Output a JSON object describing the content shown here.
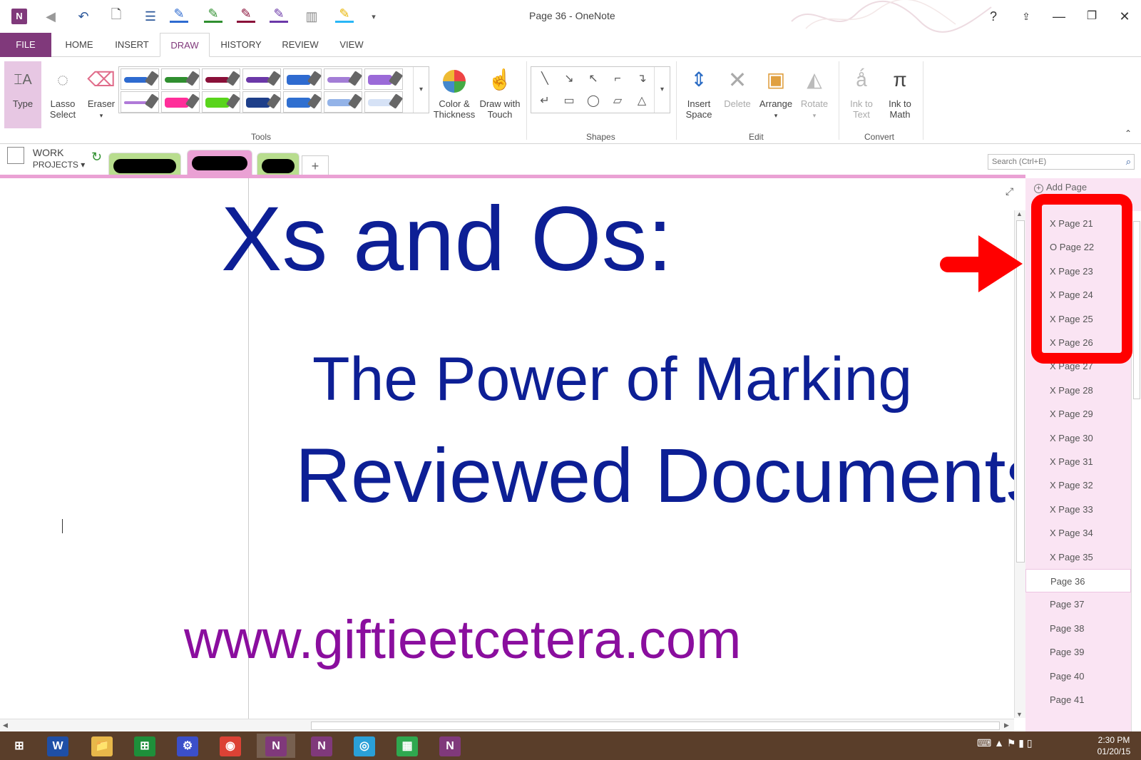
{
  "window": {
    "title": "Page 36 - OneNote",
    "buttons": {
      "help": "?",
      "restore_ribbon": "⇪",
      "minimize": "—",
      "maximize": "❐",
      "close": "✕"
    }
  },
  "quick_access": [
    {
      "name": "onenote-logo-icon",
      "glyph": "N"
    },
    {
      "name": "back-icon",
      "glyph": "◀"
    },
    {
      "name": "undo-icon",
      "glyph": "↶"
    },
    {
      "name": "delete-page-icon",
      "glyph": "🗋"
    },
    {
      "name": "bullets-icon",
      "glyph": "☰"
    },
    {
      "name": "pen-blue-icon",
      "glyph": "✎"
    },
    {
      "name": "pen-green-icon",
      "glyph": "✎"
    },
    {
      "name": "pen-red-icon",
      "glyph": "✎"
    },
    {
      "name": "pen-purple-icon",
      "glyph": "✎"
    },
    {
      "name": "dock-icon",
      "glyph": "▥"
    },
    {
      "name": "highlighter-icon",
      "glyph": "✎"
    },
    {
      "name": "customize-icon",
      "glyph": "▾"
    }
  ],
  "menu": {
    "tabs": [
      "FILE",
      "HOME",
      "INSERT",
      "DRAW",
      "HISTORY",
      "REVIEW",
      "VIEW"
    ],
    "active": "DRAW"
  },
  "ribbon": {
    "type": {
      "label": "Type"
    },
    "lasso": {
      "line1": "Lasso",
      "line2": "Select"
    },
    "eraser": {
      "label": "Eraser",
      "arrow": "▾"
    },
    "pens": [
      {
        "color": "#2e6bd0"
      },
      {
        "color": "#2f8f2f"
      },
      {
        "color": "#8a1039"
      },
      {
        "color": "#6b38a8"
      },
      {
        "color": "#2f6bd0"
      },
      {
        "color": "#a37dd6"
      },
      {
        "color": "#9b6ad8"
      },
      {
        "color": "#b07ad8"
      },
      {
        "color": "#ff2e9a"
      },
      {
        "color": "#59d41c"
      },
      {
        "color": "#1e3f8a"
      },
      {
        "color": "#2f6fd0"
      },
      {
        "color": "#93b3e8"
      },
      {
        "color": "#d6e2f6"
      }
    ],
    "more_arrow": "▾",
    "color_thickness": {
      "line1": "Color &",
      "line2": "Thickness"
    },
    "draw_touch": {
      "line1": "Draw with",
      "line2": "Touch"
    },
    "tools_label": "Tools",
    "shapes": [
      "╲",
      "↘",
      "↖",
      "⌐",
      "↴",
      "↵",
      "▭",
      "◯",
      "▱",
      "△"
    ],
    "shapes_label": "Shapes",
    "insert_space": {
      "line1": "Insert",
      "line2": "Space"
    },
    "delete": {
      "label": "Delete"
    },
    "arrange": {
      "label": "Arrange",
      "arrow": "▾"
    },
    "rotate": {
      "label": "Rotate",
      "arrow": "▾"
    },
    "edit_label": "Edit",
    "ink_text": {
      "line1": "Ink to",
      "line2": "Text"
    },
    "ink_math": {
      "line1": "Ink to",
      "line2": "Math"
    },
    "convert_label": "Convert",
    "collapse": "⌃"
  },
  "notebook": {
    "line1": "WORK",
    "line2": "PROJECTS",
    "dropdown": "▾",
    "sync": "↻",
    "add_tab": "+",
    "search_placeholder": "Search (Ctrl+E)",
    "search_icon": "⌕"
  },
  "page": {
    "title": "Xs and Os:",
    "line2": "The Power of Marking",
    "line3": "Reviewed Documents",
    "url": "www.giftieetcetera.com",
    "expand": "⤢"
  },
  "pages_pane": {
    "add_page": "Add Page",
    "items": [
      "X Page 21",
      "O Page 22",
      "X Page 23",
      "X Page 24",
      "X Page 25",
      "X Page 26",
      "X Page 27",
      "X Page 28",
      "X Page 29",
      "X Page 30",
      "X Page 31",
      "X Page 32",
      "X Page 33",
      "X Page 34",
      "X Page 35",
      "Page 36",
      "Page 37",
      "Page 38",
      "Page 39",
      "Page 40",
      "Page 41"
    ],
    "current": "Page 36"
  },
  "taskbar": {
    "apps": [
      {
        "name": "start-icon",
        "glyph": "⊞",
        "bg": ""
      },
      {
        "name": "word-icon",
        "glyph": "W",
        "bg": "#1f4fa6"
      },
      {
        "name": "file-explorer-icon",
        "glyph": "📁",
        "bg": "#e8b84a"
      },
      {
        "name": "store-icon",
        "glyph": "⊞",
        "bg": "#1e8f3a"
      },
      {
        "name": "settings-icon",
        "glyph": "⚙",
        "bg": "#3b4fc9"
      },
      {
        "name": "chrome-icon",
        "glyph": "◉",
        "bg": "#dc4235"
      },
      {
        "name": "onenote-icon",
        "glyph": "N",
        "bg": "#80397b"
      },
      {
        "name": "onenote-clipper-icon",
        "glyph": "N",
        "bg": "#80397b"
      },
      {
        "name": "camera-icon",
        "glyph": "◎",
        "bg": "#2aa0d8"
      },
      {
        "name": "calculator-icon",
        "glyph": "▦",
        "bg": "#2fa84f"
      },
      {
        "name": "onenote-app-icon",
        "glyph": "N",
        "bg": "#80397b"
      }
    ],
    "tray": "⌨ ▲ ⚑ ▮ ▯",
    "time": "2:30 PM",
    "date": "01/20/15"
  }
}
